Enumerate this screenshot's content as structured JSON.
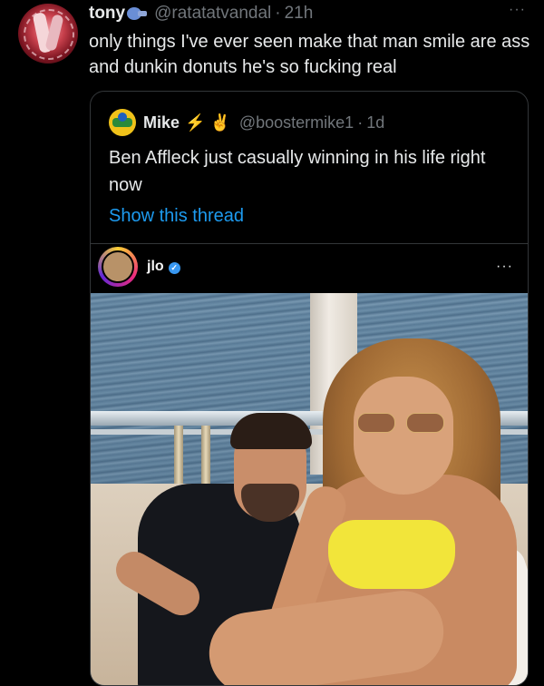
{
  "tweet": {
    "name": "tony",
    "handle": "@ratatatvandal",
    "separator": "·",
    "time": "21h",
    "more": "···",
    "text": "only things I've ever seen make that man smile are ass and dunkin donuts he's so fucking real"
  },
  "quote": {
    "name": "Mike",
    "emojis": "⚡ ✌",
    "handle": "@boostermike1",
    "separator": "·",
    "time": "1d",
    "text": "Ben Affleck just casually winning in his life right now",
    "link": "Show this thread"
  },
  "instagram": {
    "username": "jlo",
    "verified_glyph": "✓",
    "more": "···"
  },
  "colors": {
    "background": "#000000",
    "text": "#e7e9ea",
    "muted": "#71767b",
    "link": "#1d9bf0",
    "border": "#333639",
    "verified": "#3897f0"
  },
  "icons": {
    "tweet_avatar": "avatar-image",
    "name_badge": "emoji-badge-icon",
    "more": "more-dots-icon",
    "verified": "verified-check-icon"
  }
}
